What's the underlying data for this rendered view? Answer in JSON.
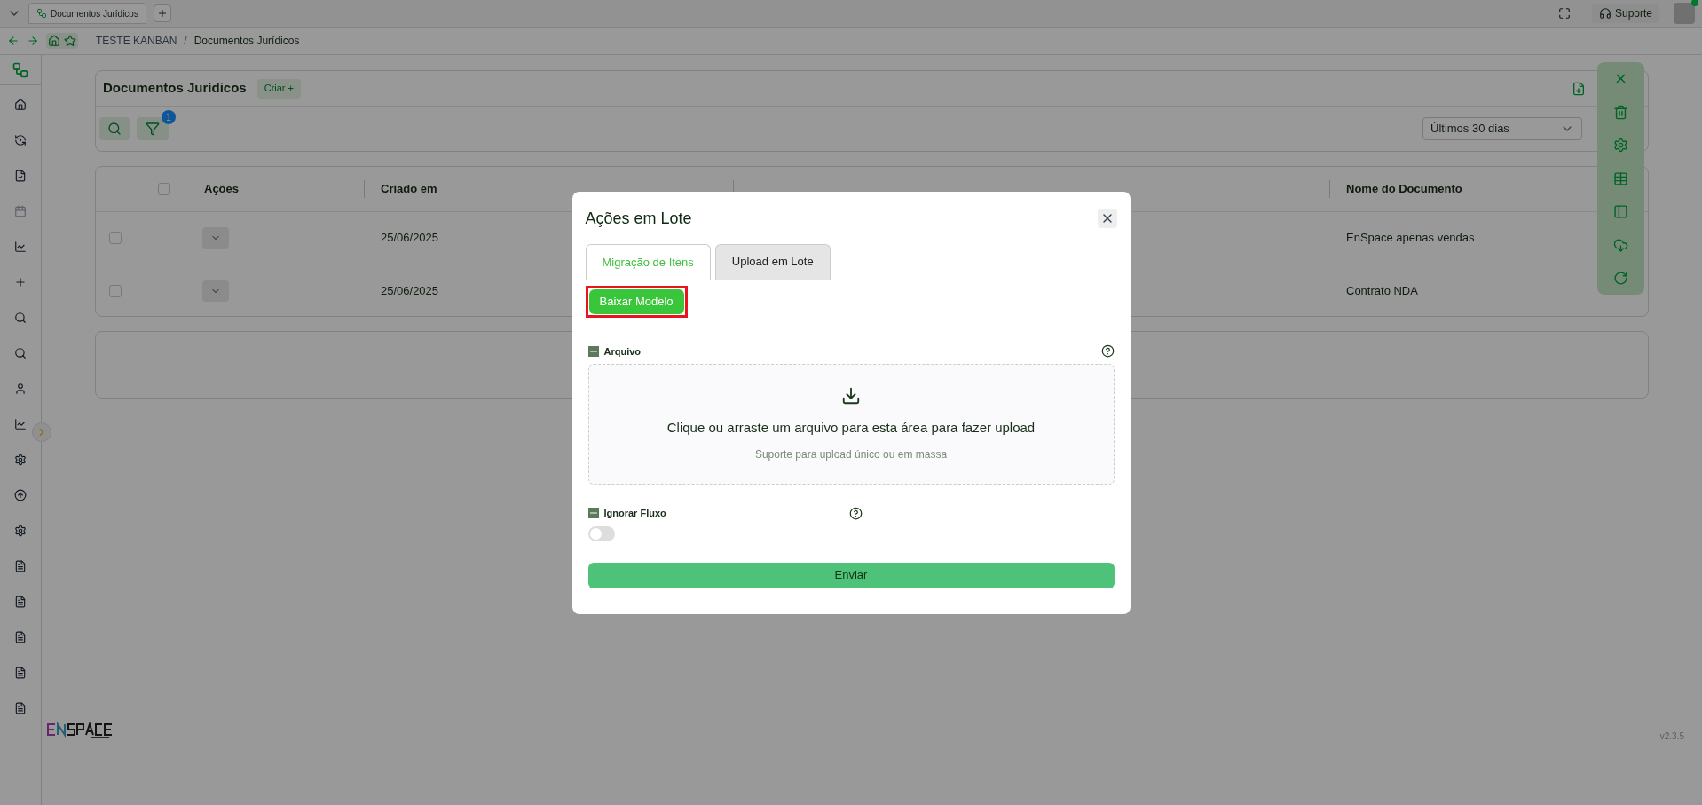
{
  "browser_tabs": [
    {
      "label": "Documentos Jurídicos",
      "selected": true
    }
  ],
  "top_right": {
    "support": "Suporte"
  },
  "breadcrumb": [
    "TESTE KANBAN",
    "Documentos Jurídicos"
  ],
  "breadcrumb_separator": "/",
  "page": {
    "title": "Documentos Jurídicos",
    "create_button": "Criar +",
    "filter_badge": "1",
    "period_select": "Últimos 30 dias"
  },
  "table": {
    "header_checked": false,
    "columns": [
      "Ações",
      "Criado em",
      "Nome do Documento"
    ],
    "rows": [
      {
        "checked": false,
        "created": "25/06/2025",
        "name": "EnSpace apenas vendas"
      },
      {
        "checked": false,
        "created": "25/06/2025",
        "name": "Contrato NDA"
      }
    ]
  },
  "version": "v2.3.5",
  "modal": {
    "title": "Ações em Lote",
    "tabs": [
      {
        "label": "Migração de Itens",
        "selected": true
      },
      {
        "label": "Upload em Lote",
        "selected": false
      }
    ],
    "download_button": "Baixar Modelo",
    "file_label": "Arquivo",
    "upload_text": "Clique ou arraste um arquivo para esta área para fazer upload",
    "upload_hint": "Suporte para upload único ou em massa",
    "ignore_label": "Ignorar Fluxo",
    "ignore_on": false,
    "submit": "Enviar"
  }
}
